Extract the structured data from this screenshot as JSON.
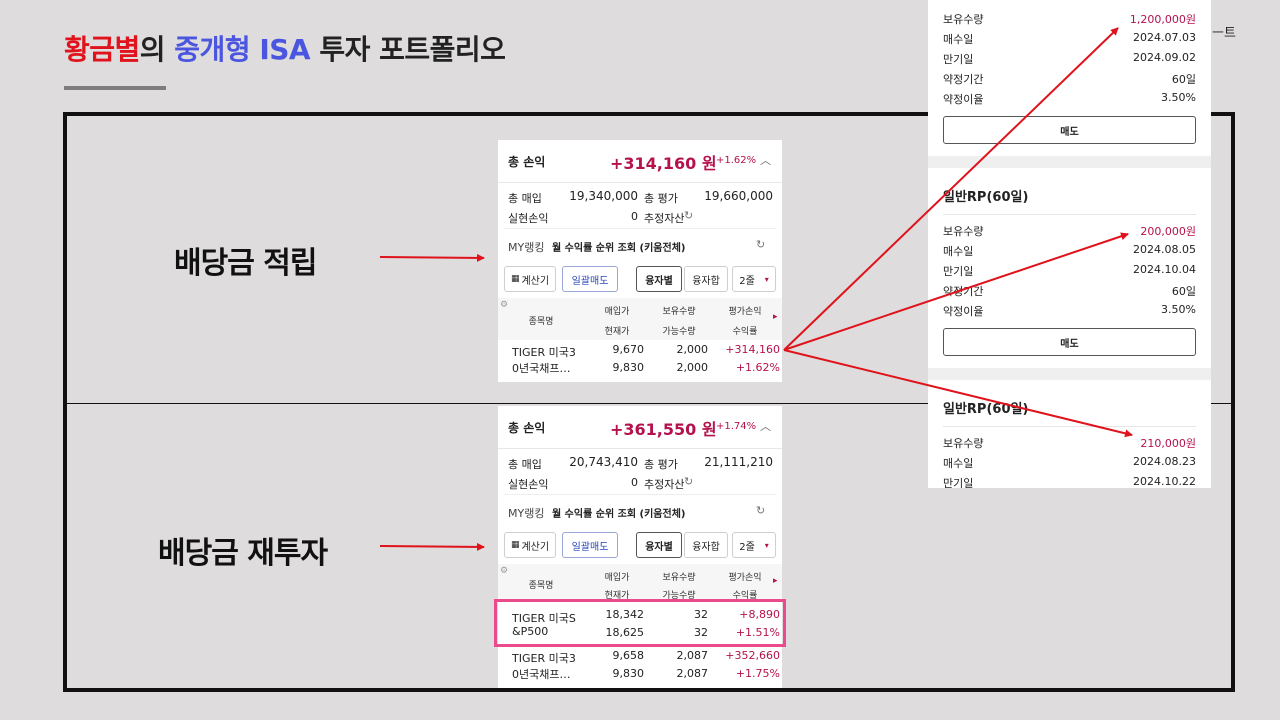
{
  "title": {
    "part1": "황금별",
    "part2": "의 ",
    "part3": "중개형 ISA",
    "part4": " 투자 포트폴리오"
  },
  "top_right_caption": "ㅡ트",
  "labels": {
    "accumulate": "배당금 적립",
    "reinvest": "배당금 재투자"
  },
  "panel1": {
    "total_label": "총 손익",
    "total_amount": "+314,160 원",
    "total_pct": "+1.62%",
    "buy_label": "총 매입",
    "buy_value": "19,340,000",
    "eval_label": "총 평가",
    "eval_value": "19,660,000",
    "realized_label": "실현손익",
    "realized_value": "0",
    "est_label": "추정자산",
    "ranking_label": "MY랭킹",
    "ranking_text": "월 수익률 순위 조회 (키움전체)",
    "buttons": {
      "calc": "계산기",
      "bulk_sell": "일괄매도",
      "by_user": "융자별",
      "combined": "융자합",
      "rows": "2줄"
    },
    "headers": {
      "name": "종목명",
      "buy_price": "매입가",
      "cur_price": "현재가",
      "holding": "보유수량",
      "available": "가능수량",
      "pl": "평가손익",
      "rate": "수익률"
    },
    "rows": [
      {
        "name1": "TIGER 미국3",
        "name2": "0년국채프…",
        "buy": "9,670",
        "cur": "9,830",
        "hold": "2,000",
        "avail": "2,000",
        "pl": "+314,160",
        "rate": "+1.62%"
      }
    ]
  },
  "panel2": {
    "total_label": "총 손익",
    "total_amount": "+361,550 원",
    "total_pct": "+1.74%",
    "buy_label": "총 매입",
    "buy_value": "20,743,410",
    "eval_label": "총 평가",
    "eval_value": "21,111,210",
    "realized_label": "실현손익",
    "realized_value": "0",
    "est_label": "추정자산",
    "ranking_label": "MY랭킹",
    "ranking_text": "월 수익률 순위 조회 (키움전체)",
    "buttons": {
      "calc": "계산기",
      "bulk_sell": "일괄매도",
      "by_user": "융자별",
      "combined": "융자합",
      "rows": "2줄"
    },
    "headers": {
      "name": "종목명",
      "buy_price": "매입가",
      "cur_price": "현재가",
      "holding": "보유수량",
      "available": "가능수량",
      "pl": "평가손익",
      "rate": "수익률"
    },
    "rows": [
      {
        "name1": "TIGER 미국S",
        "name2": "&P500",
        "buy": "18,342",
        "cur": "18,625",
        "hold": "32",
        "avail": "32",
        "pl": "+8,890",
        "rate": "+1.51%"
      },
      {
        "name1": "TIGER 미국3",
        "name2": "0년국채프…",
        "buy": "9,658",
        "cur": "9,830",
        "hold": "2,087",
        "avail": "2,087",
        "pl": "+352,660",
        "rate": "+1.75%"
      }
    ]
  },
  "rp": {
    "block1": {
      "holding_label": "보유수량",
      "holding_value": "1,200,000원",
      "buy_date_label": "매수일",
      "buy_date": "2024.07.03",
      "maturity_label": "만기일",
      "maturity": "2024.09.02",
      "term_label": "약정기간",
      "term": "60일",
      "rate_label": "약정이율",
      "rate": "3.50%",
      "sell": "매도"
    },
    "block2": {
      "title": "일반RP(60일)",
      "holding_label": "보유수량",
      "holding_value": "200,000원",
      "buy_date_label": "매수일",
      "buy_date": "2024.08.05",
      "maturity_label": "만기일",
      "maturity": "2024.10.04",
      "term_label": "약정기간",
      "term": "60일",
      "rate_label": "약정이율",
      "rate": "3.50%",
      "sell": "매도"
    },
    "block3": {
      "title": "일반RP(60일)",
      "holding_label": "보유수량",
      "holding_value": "210,000원",
      "buy_date_label": "매수일",
      "buy_date": "2024.08.23",
      "maturity_label": "만기일",
      "maturity": "2024.10.22"
    }
  },
  "colors": {
    "accent_red": "#e0121b",
    "accent_blue": "#4a55e0",
    "profit": "#b5124d",
    "arrow": "#e0121b",
    "highlight": "#ea4b8a"
  }
}
